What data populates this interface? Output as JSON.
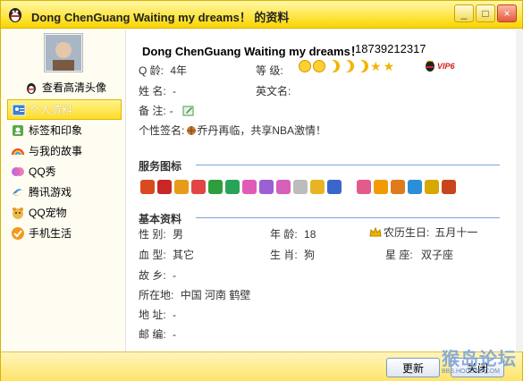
{
  "window": {
    "title": "Dong ChenGuang Waiting my dreams！ 的资料",
    "min_label": "_",
    "max_label": "□",
    "close_label": "×"
  },
  "sidebar": {
    "avatar_link": "查看高清头像",
    "items": [
      {
        "label": "个人资料",
        "icon": "person-card-icon",
        "active": true
      },
      {
        "label": "标签和印象",
        "icon": "tag-icon"
      },
      {
        "label": "与我的故事",
        "icon": "rainbow-icon"
      },
      {
        "label": "QQ秀",
        "icon": "qq-show-icon"
      },
      {
        "label": "腾讯游戏",
        "icon": "game-icon"
      },
      {
        "label": "QQ宠物",
        "icon": "pet-icon"
      },
      {
        "label": "手机生活",
        "icon": "mobile-life-icon"
      }
    ]
  },
  "profile": {
    "nickname": "Dong ChenGuang Waiting my dreams！",
    "qq_number": "18739212317",
    "q_age_label": "Q  龄:",
    "q_age_value": "4年",
    "level_label": "等  级:",
    "vip_text": "VIP6",
    "name_label": "姓  名:",
    "name_value": "-",
    "english_name_label": "英文名:",
    "english_name_value": "",
    "remark_label": "备  注:",
    "remark_value": "-",
    "signature_label": "个性签名:",
    "signature_value": "乔丹再临，共享NBA激情！"
  },
  "services": {
    "title": "服务图标",
    "colors": [
      "#d94a1e",
      "#c92626",
      "#e89a1a",
      "#e04646",
      "#2e9e3c",
      "#2aa35a",
      "#e05bb5",
      "#9b5fd6",
      "#d65fb8",
      "#bcbcbc",
      "#e8b424",
      "#3a66cc",
      "#e45a8c",
      "#f29a00",
      "#e07a1a",
      "#2a8fd6",
      "#d7a800",
      "#c8441c"
    ]
  },
  "basic": {
    "title": "基本资料",
    "gender_label": "性  别:",
    "gender_value": "男",
    "age_label": "年  龄:",
    "age_value": "18",
    "lunar_label": "农历生日:",
    "lunar_value": "五月十一",
    "blood_label": "血  型:",
    "blood_value": "其它",
    "zodiac_label": "生  肖:",
    "zodiac_value": "狗",
    "constellation_label": "星    座:",
    "constellation_value": "双子座",
    "hometown_label": "故  乡:",
    "hometown_value": "-",
    "location_label": "所在地:",
    "location_value": "中国 河南 鹤壁",
    "address_label": "地  址:",
    "address_value": "-",
    "postcode_label": "邮  编:",
    "postcode_value": "-"
  },
  "footer": {
    "refresh_label": "更新",
    "close_label": "关闭",
    "watermark_text": "猴岛论坛",
    "watermark_sub": "BBS.HOUDAO.COM"
  }
}
